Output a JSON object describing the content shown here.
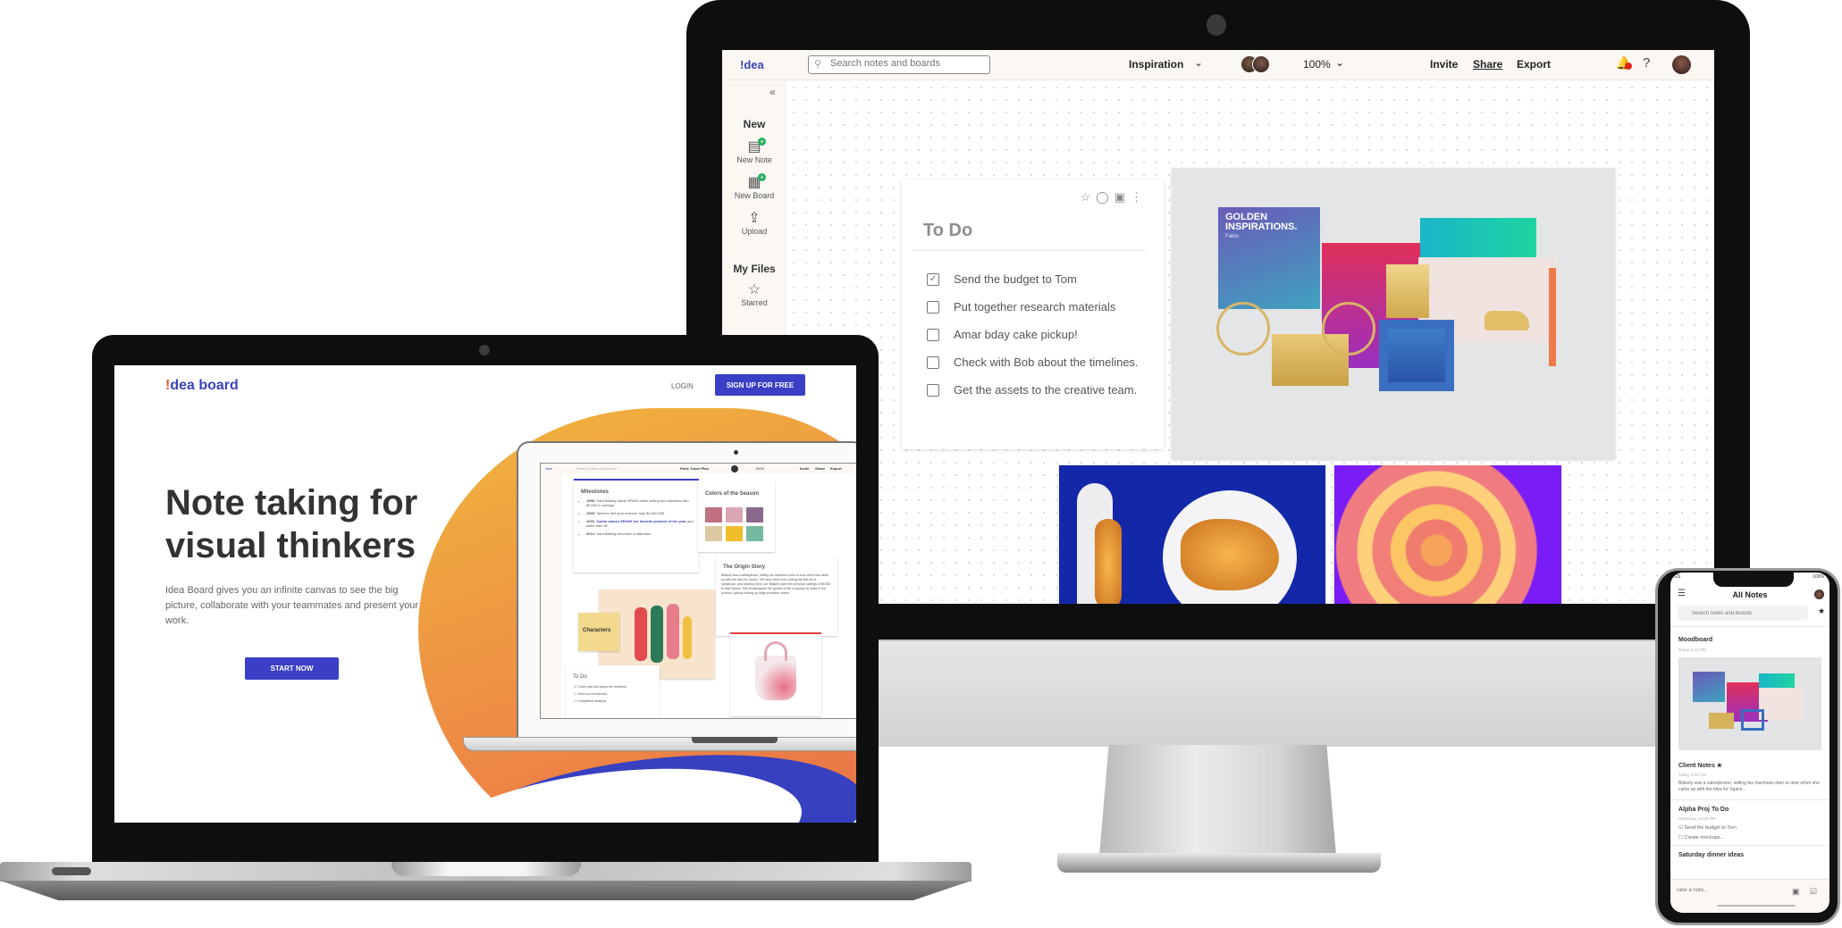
{
  "desktop_app": {
    "logo": "!dea",
    "search_placeholder": "Search notes and boards",
    "board_name": "Inspiration",
    "zoom_level": "100%",
    "header_links": {
      "invite": "Invite",
      "share": "Share",
      "export": "Export"
    },
    "notification_count": "1",
    "help": "?",
    "sidebar": {
      "collapse": "«",
      "new_heading": "New",
      "new_items": [
        {
          "label": "New Note",
          "icon": "new-note-icon"
        },
        {
          "label": "New Board",
          "icon": "new-board-icon"
        },
        {
          "label": "Upload",
          "icon": "upload-icon"
        }
      ],
      "files_heading": "My Files",
      "files_items": [
        {
          "label": "Starred",
          "icon": "star-icon"
        }
      ]
    },
    "todo_card": {
      "title": "To Do",
      "tools": [
        "star-icon",
        "tag-icon",
        "comment-icon",
        "more-icon"
      ],
      "items": [
        {
          "text": "Send the budget to Tom",
          "checked": true
        },
        {
          "text": "Put together research materials",
          "checked": false
        },
        {
          "text": "Amar bday cake pickup!",
          "checked": false
        },
        {
          "text": "Check with Bob about the timelines.",
          "checked": false
        },
        {
          "text": "Get the assets to the creative team.",
          "checked": false
        }
      ]
    },
    "moodboard_image": {
      "title": "GOLDEN INSPIRATIONS.",
      "subtitle": "Fabio"
    }
  },
  "landing_page": {
    "logo_bang": "!",
    "logo_rest": "dea board",
    "login": "LOGIN",
    "signup": "SIGN UP FOR FREE",
    "headline": "Note taking for visual thinkers",
    "description": "Idea Board gives you an infinite canvas to see the big picture, collaborate with your teammates and present your work.",
    "cta": "START NOW",
    "preview": {
      "logo": "!dea",
      "search_placeholder": "Search notes and boards",
      "board_name": "Paris Travel Plan",
      "zoom_level": "100%",
      "header_links": [
        "Invite",
        "Share",
        "Export"
      ],
      "milestones": {
        "title": "Milestones",
        "items": [
          {
            "year": "1998:",
            "text": "Sara Blakely starts SPANX while selling fax machines with $5,000 in savings."
          },
          {
            "year": "1999:",
            "text": "Spanx's first year revenue tops $4,000,000."
          },
          {
            "year": "2000:",
            "highlight": "Oprah names SPANX her favorite product of the year",
            "text": " and sales take off."
          },
          {
            "year": "2012:",
            "text": "Sara Blakely becomes a billionaire."
          }
        ]
      },
      "colors_card": {
        "title": "Colors of the Season",
        "swatches": [
          "#c0707f",
          "#dba6b3",
          "#8a6a8a",
          "#dcc9a4",
          "#f0be2a",
          "#76b9a1"
        ]
      },
      "origin_card": {
        "title": "The Origin Story",
        "text": "Blakely was a salesperson, selling fax machines door to door when she came up with the idea for Spanx. The idea came from cutting the feet off of pantyhose, and wearing them out. Blakely used her personal savings of $5,000 to start Spanx. She bootstrapped the growth of the company on sales of her product, quickly locking up large purchase orders."
      },
      "characters_label": "Characters",
      "todo": {
        "title": "To Do",
        "items": [
          {
            "text": "Check with Bob about the timelines.",
            "checked": true
          },
          {
            "text": "Send our moodboard.",
            "checked": false
          },
          {
            "text": "Competitive analysis",
            "checked": false
          }
        ]
      }
    }
  },
  "mobile_app": {
    "status_left": "GS",
    "status_right": "100%",
    "title": "All Notes",
    "search_placeholder": "Search notes and boards",
    "notes": [
      {
        "title": "Moodboard",
        "time": "Today, 6:11 PM"
      },
      {
        "title": "Client Notes ★",
        "time": "Today, 9:20 AM",
        "text": "Blakely was a salesperson, selling fax machines door to door when she came up with the idea for Spanx..."
      },
      {
        "title": "Alpha Proj To Do",
        "time": "Yesterday, 12:02 PM",
        "items": [
          {
            "text": "Send the budget to Tom",
            "checked": true
          },
          {
            "text": "Create mockups...",
            "checked": false
          }
        ]
      },
      {
        "title": "Saturday dinner ideas"
      }
    ],
    "note_input_placeholder": "Take a note..."
  },
  "colors": {
    "brand_blue": "#3a3fc6",
    "accent_orange": "#ee8745",
    "notification_red": "#e0251c",
    "new_badge_green": "#27ae60"
  }
}
